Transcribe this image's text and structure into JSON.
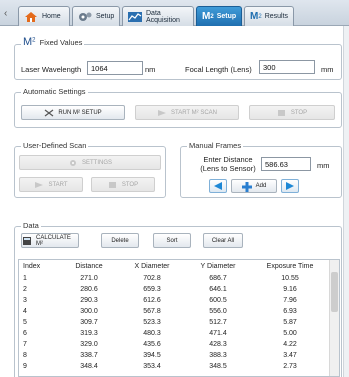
{
  "tabs": [
    {
      "label": "Home"
    },
    {
      "label": "Setup"
    },
    {
      "label": "Data Acquisition"
    },
    {
      "label_prefix": "M",
      "label_sup": "2",
      "label": "Setup"
    },
    {
      "label_prefix": "M",
      "label_sup": "2",
      "label": "Results"
    }
  ],
  "fixed_values": {
    "title_prefix": "M",
    "title_sup": "2",
    "title": "Fixed Values",
    "wavelength_label": "Laser Wavelength",
    "wavelength_value": "1064",
    "wavelength_unit": "nm",
    "focal_label": "Focal Length (Lens)",
    "focal_value": "300",
    "focal_unit": "mm"
  },
  "automatic": {
    "title": "Automatic Settings",
    "run_label": "RUN M² SETUP",
    "start_label": "START M² SCAN",
    "stop_label": "STOP"
  },
  "user_scan": {
    "title": "User-Defined Scan",
    "settings_label": "SETTINGS",
    "start_label": "START",
    "stop_label": "STOP"
  },
  "manual": {
    "title": "Manual Frames",
    "enter_line1": "Enter Distance",
    "enter_line2": "(Lens to Sensor)",
    "distance_value": "586.63",
    "distance_unit": "mm",
    "add_label": "Add"
  },
  "data": {
    "title": "Data",
    "calc_label": "CALCULATE M²",
    "delete_label": "Delete",
    "sort_label": "Sort",
    "clear_label": "Clear All",
    "columns": [
      "Index",
      "Distance",
      "X Diameter",
      "Y Diameter",
      "Exposure Time"
    ],
    "rows": [
      [
        "1",
        "271.0",
        "702.8",
        "686.7",
        "10.55"
      ],
      [
        "2",
        "280.6",
        "659.3",
        "646.1",
        "9.16"
      ],
      [
        "3",
        "290.3",
        "612.6",
        "600.5",
        "7.96"
      ],
      [
        "4",
        "300.0",
        "567.8",
        "556.0",
        "6.93"
      ],
      [
        "5",
        "309.7",
        "523.3",
        "512.7",
        "5.87"
      ],
      [
        "6",
        "319.3",
        "480.3",
        "471.4",
        "5.00"
      ],
      [
        "7",
        "329.0",
        "435.6",
        "428.3",
        "4.22"
      ],
      [
        "8",
        "338.7",
        "394.5",
        "388.3",
        "3.47"
      ],
      [
        "9",
        "348.4",
        "353.4",
        "348.5",
        "2.73"
      ]
    ]
  },
  "colors": {
    "accent": "#1f6fb0",
    "arrow": "#1e88d6",
    "add": "#2a7fd0"
  }
}
